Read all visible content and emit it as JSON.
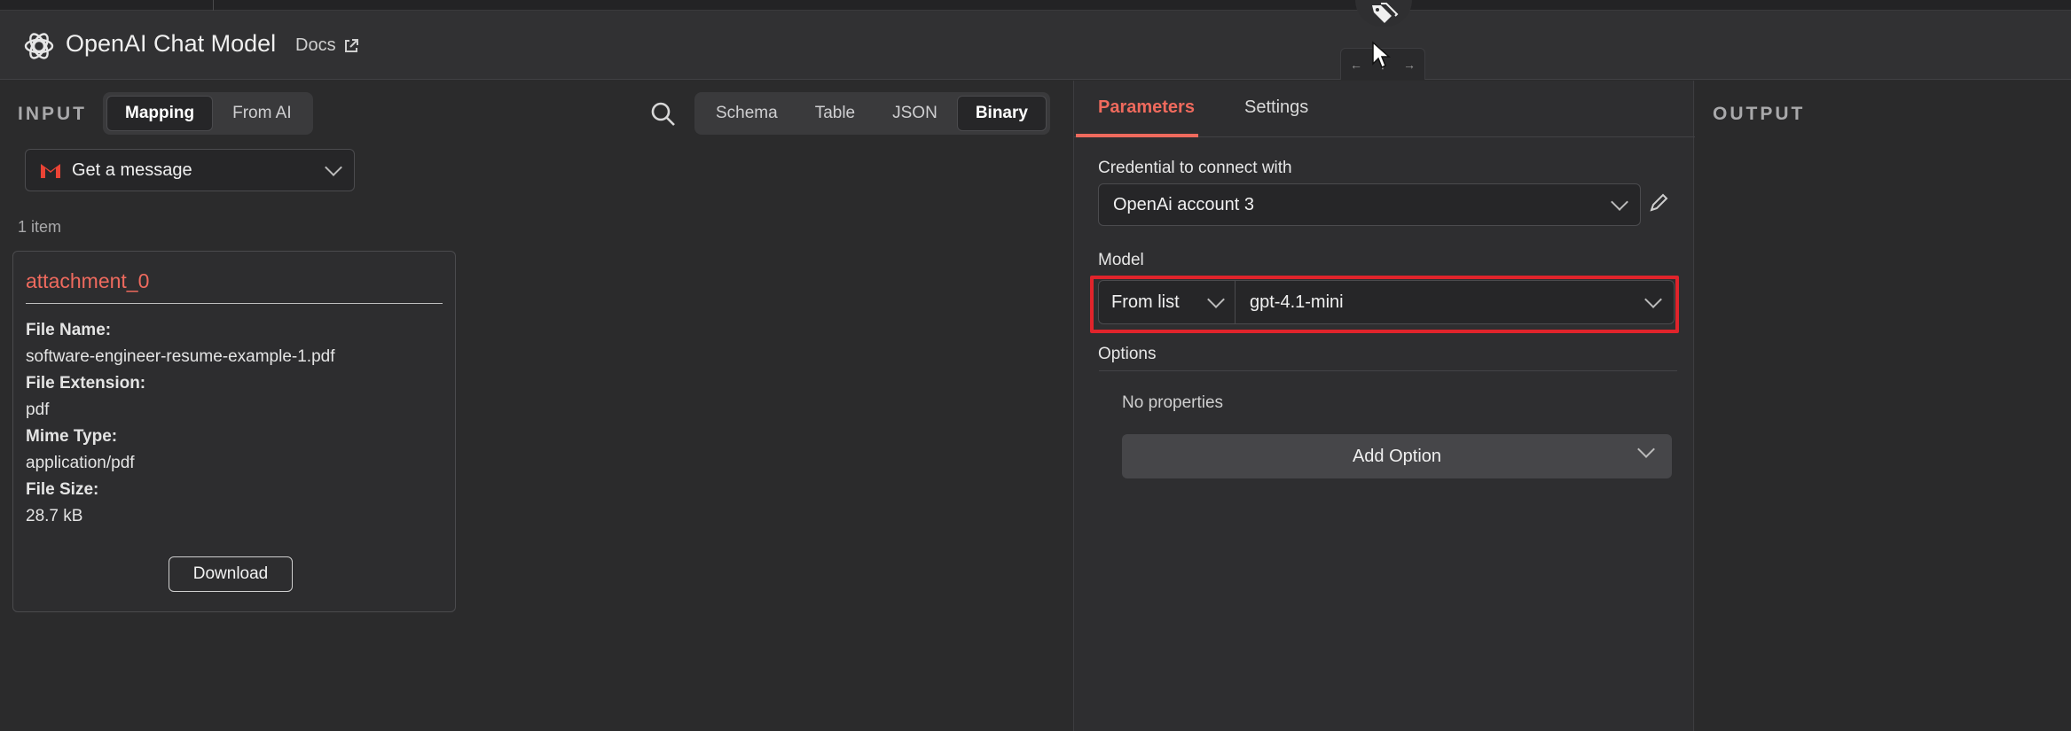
{
  "header": {
    "title": "OpenAI Chat Model",
    "docs_label": "Docs"
  },
  "input": {
    "label": "INPUT",
    "modes": [
      "Mapping",
      "From AI"
    ],
    "views": [
      "Schema",
      "Table",
      "JSON",
      "Binary"
    ],
    "node_select": "Get a message",
    "item_count": "1 item",
    "binary": {
      "name": "attachment_0",
      "file_name_key": "File Name:",
      "file_name": "software-engineer-resume-example-1.pdf",
      "file_ext_key": "File Extension:",
      "file_ext": "pdf",
      "mime_key": "Mime Type:",
      "mime": "application/pdf",
      "size_key": "File Size:",
      "size": "28.7 kB",
      "download_label": "Download"
    }
  },
  "params": {
    "tabs": [
      "Parameters",
      "Settings"
    ],
    "credential_label": "Credential to connect with",
    "credential_value": "OpenAi account 3",
    "model_label": "Model",
    "model_mode": "From list",
    "model_value": "gpt-4.1-mini",
    "options_label": "Options",
    "no_properties": "No properties",
    "add_option": "Add Option"
  },
  "output": {
    "label": "OUTPUT"
  },
  "colors": {
    "accent": "#ef6a5d",
    "highlight_box": "#e0242b",
    "gmail_red": "#ea4335"
  }
}
